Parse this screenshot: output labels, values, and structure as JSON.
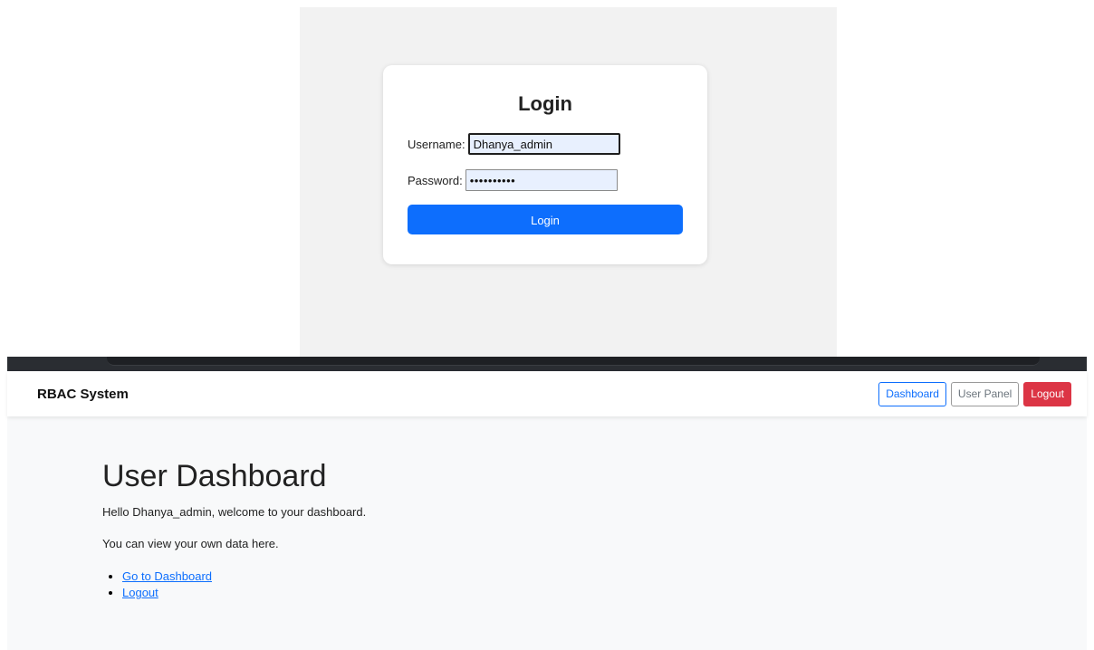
{
  "login": {
    "title": "Login",
    "username_label": "Username:",
    "username_value": "Dhanya_admin",
    "password_label": "Password:",
    "password_value": "••••••••••",
    "button_label": "Login"
  },
  "navbar": {
    "brand": "RBAC System",
    "dashboard_label": "Dashboard",
    "user_panel_label": "User Panel",
    "logout_label": "Logout"
  },
  "dashboard": {
    "title": "User Dashboard",
    "greeting": "Hello Dhanya_admin, welcome to your dashboard.",
    "info": "You can view your own data here.",
    "links": [
      "Go to Dashboard",
      "Logout"
    ]
  },
  "colors": {
    "primary": "#0d6efd",
    "danger": "#dc3545",
    "secondary": "#6c757d",
    "page_bg": "#f8f9fa",
    "login_bg": "#f2f2f2"
  }
}
